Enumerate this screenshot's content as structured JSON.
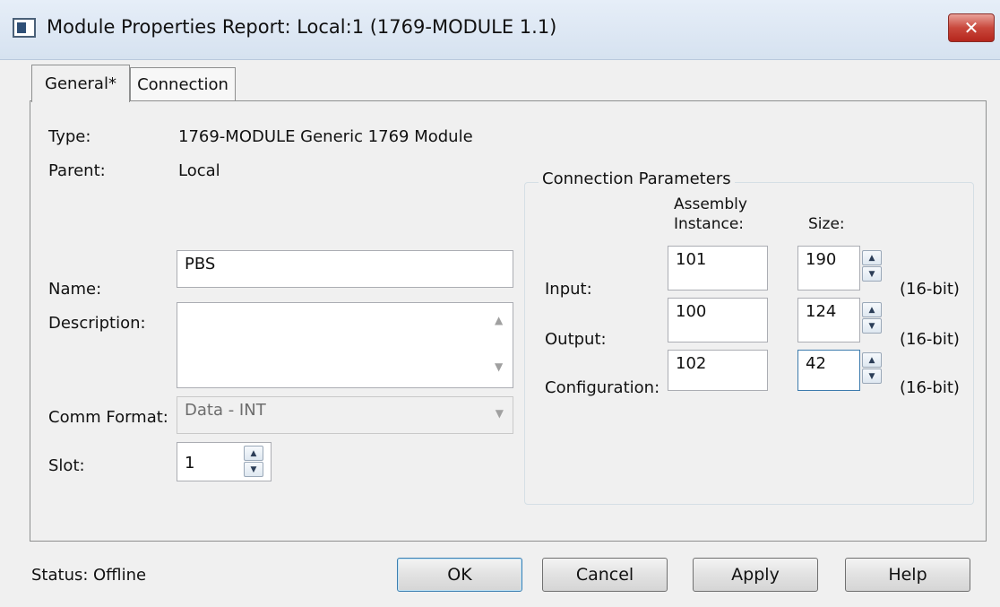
{
  "window": {
    "title": "Module Properties Report: Local:1 (1769-MODULE 1.1)",
    "close_glyph": "✕"
  },
  "tabs": [
    {
      "label": "General*",
      "active": true
    },
    {
      "label": "Connection",
      "active": false
    }
  ],
  "general": {
    "type_label": "Type:",
    "type_value": "1769-MODULE Generic 1769 Module",
    "parent_label": "Parent:",
    "parent_value": "Local",
    "name_label": "Name:",
    "name_value": "PBS",
    "description_label": "Description:",
    "description_value": "",
    "comm_format_label": "Comm Format:",
    "comm_format_value": "Data - INT",
    "slot_label": "Slot:",
    "slot_value": "1"
  },
  "connection_parameters": {
    "title": "Connection Parameters",
    "col_assembly_line1": "Assembly",
    "col_assembly_line2": "Instance:",
    "col_size": "Size:",
    "unit": "(16-bit)",
    "rows": [
      {
        "label": "Input:",
        "instance": "101",
        "size": "190"
      },
      {
        "label": "Output:",
        "instance": "100",
        "size": "124"
      },
      {
        "label": "Configuration:",
        "instance": "102",
        "size": "42"
      }
    ]
  },
  "status": {
    "label": "Status:",
    "value": "Offline"
  },
  "buttons": {
    "ok": "OK",
    "cancel": "Cancel",
    "apply": "Apply",
    "help": "Help"
  },
  "icons": {
    "spin_up": "▲",
    "spin_down": "▼",
    "scroll_up": "▲",
    "scroll_down": "▼",
    "dropdown": "▼"
  },
  "colors": {
    "close_button": "#c9483c",
    "focus_border": "#3d7bad",
    "dialog_bg": "#f0f0f0"
  }
}
